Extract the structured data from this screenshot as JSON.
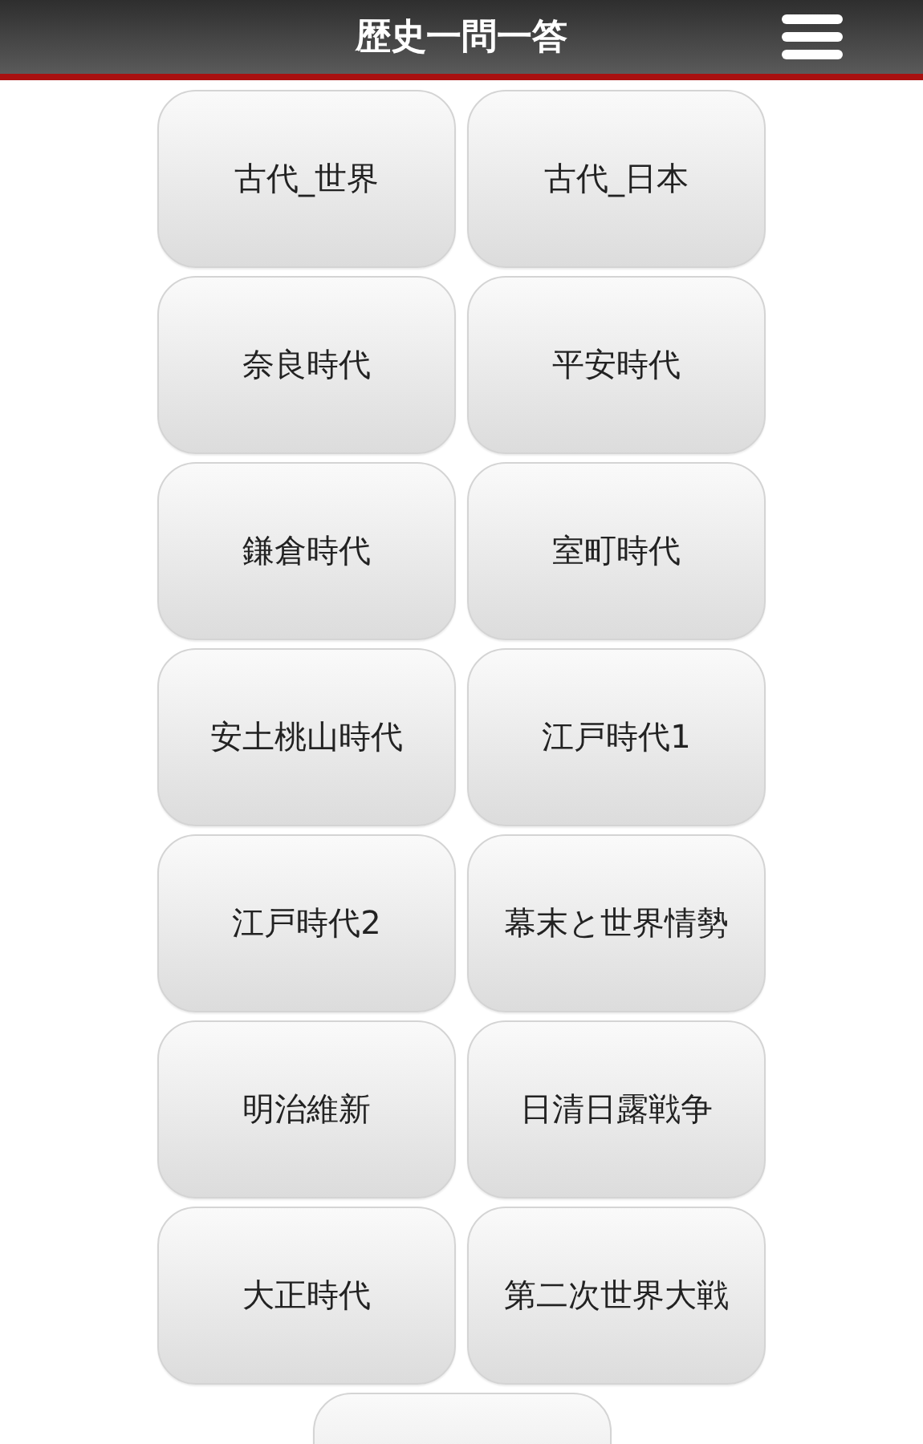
{
  "header": {
    "title": "歴史一問一答"
  },
  "topics": [
    {
      "label": "古代_世界"
    },
    {
      "label": "古代_日本"
    },
    {
      "label": "奈良時代"
    },
    {
      "label": "平安時代"
    },
    {
      "label": "鎌倉時代"
    },
    {
      "label": "室町時代"
    },
    {
      "label": "安土桃山時代"
    },
    {
      "label": "江戸時代1"
    },
    {
      "label": "江戸時代2"
    },
    {
      "label": "幕末と世界情勢"
    },
    {
      "label": "明治維新"
    },
    {
      "label": "日清日露戦争"
    },
    {
      "label": "大正時代"
    },
    {
      "label": "第二次世界大戦"
    }
  ]
}
